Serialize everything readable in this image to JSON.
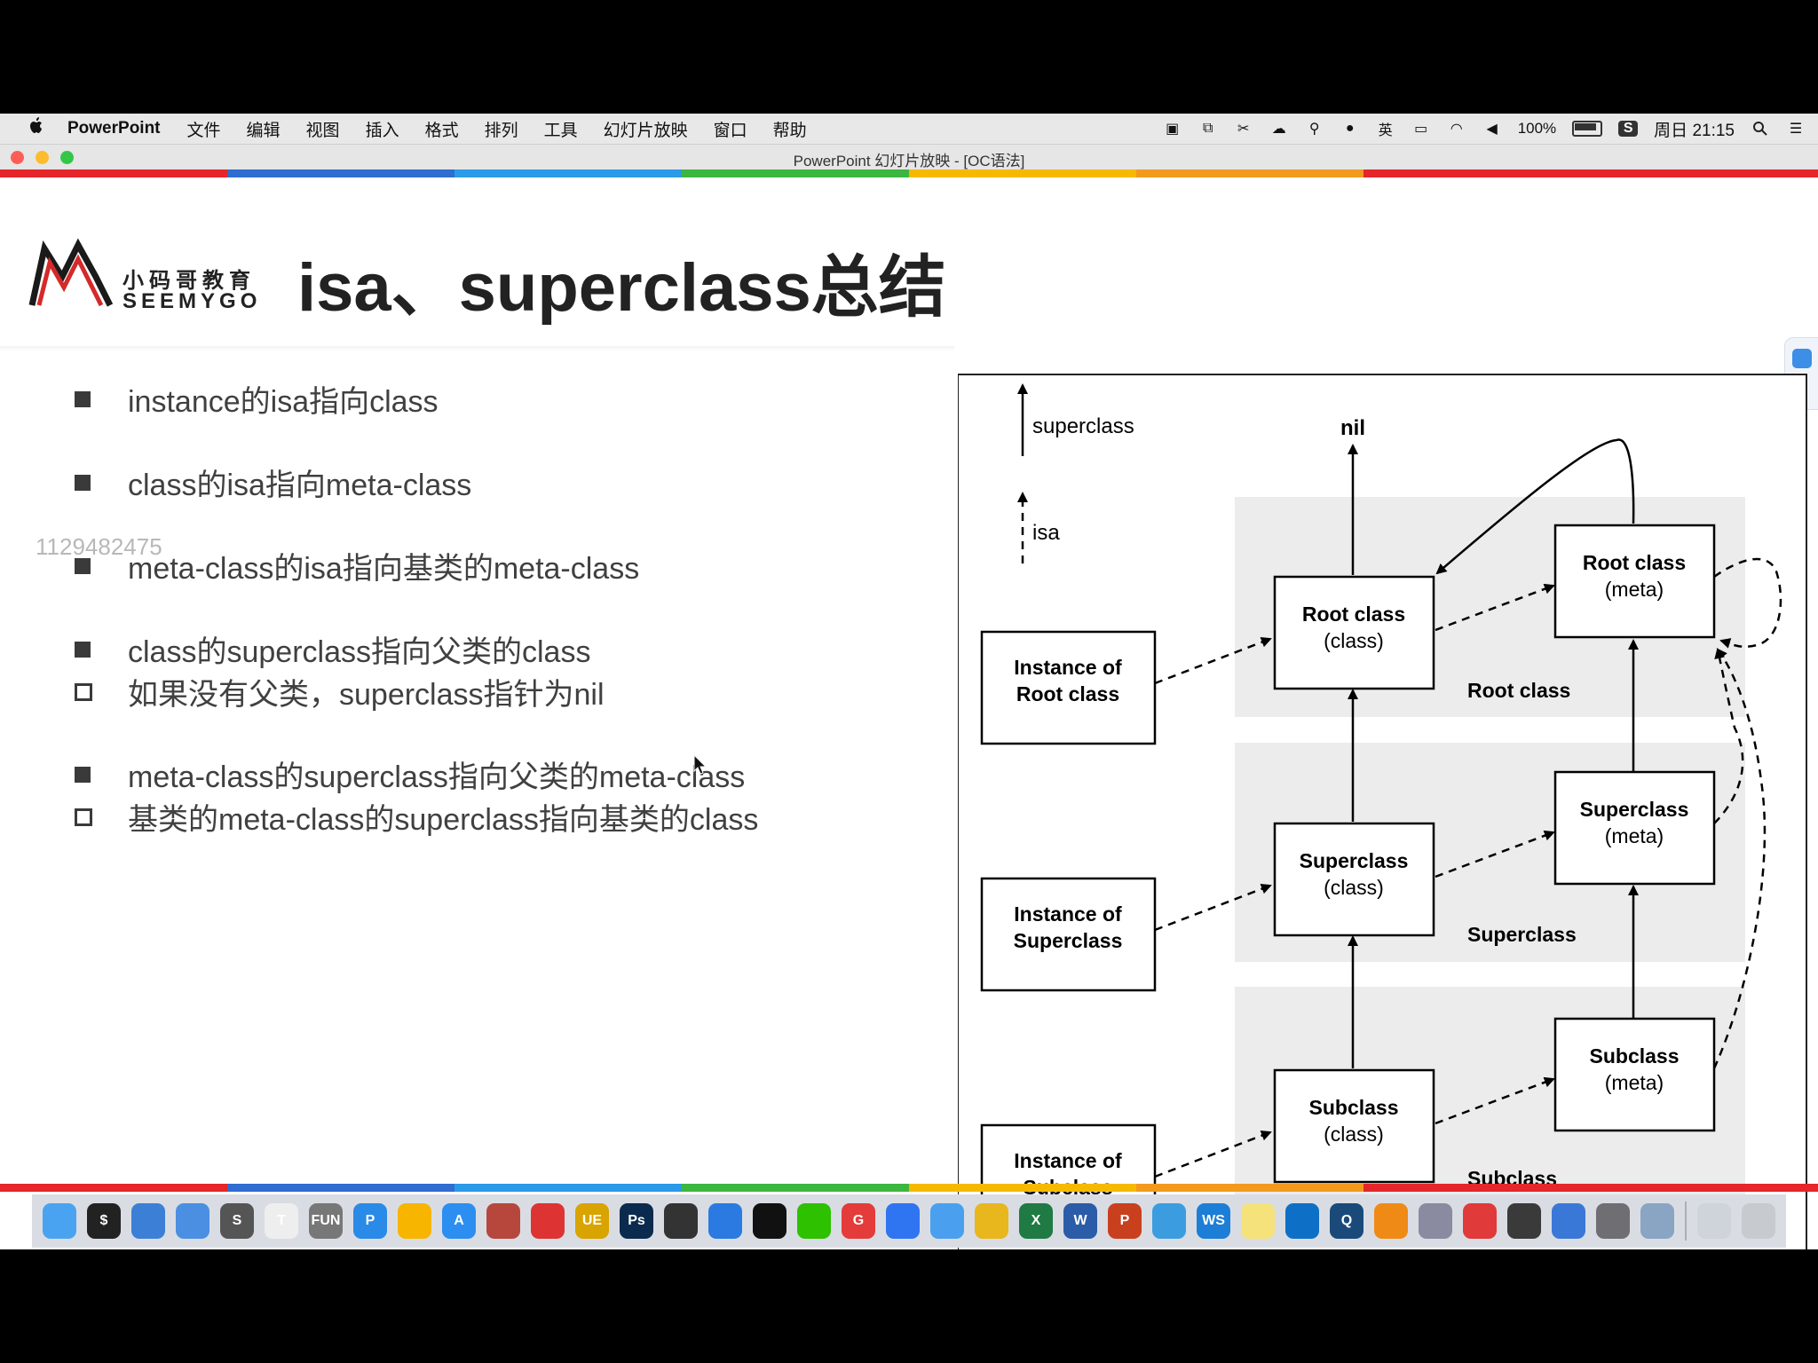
{
  "menubar": {
    "app_name": "PowerPoint",
    "items": [
      "文件",
      "编辑",
      "视图",
      "插入",
      "格式",
      "排列",
      "工具",
      "幻灯片放映",
      "窗口",
      "帮助"
    ],
    "battery": "100%",
    "clock": "周日 21:15",
    "tray_icons": [
      "screen-record-icon",
      "copy-icon",
      "scissors-icon",
      "cloud-icon",
      "network-icon",
      "mic-icon",
      "ime-icon",
      "display-icon",
      "wifi-icon",
      "volume-icon"
    ]
  },
  "window": {
    "title": "PowerPoint 幻灯片放映 - [OC语法]"
  },
  "colors": {
    "rainbow": [
      "#e5262b",
      "#2f6dd0",
      "#2b9ae8",
      "#3db63f",
      "#f7b900",
      "#f39a1e",
      "#e5262b",
      "#e5262b"
    ],
    "traffic": [
      "#fc5e57",
      "#fdbc2e",
      "#33c748"
    ]
  },
  "slide": {
    "logo_cn": "小码哥教育",
    "logo_en": "SEEMYGO",
    "title": "isa、superclass总结",
    "watermark": "1129482475",
    "bullets": [
      {
        "style": "filled",
        "text": "instance的isa指向class"
      },
      {
        "style": "filled",
        "text": "class的isa指向meta-class"
      },
      {
        "style": "filled",
        "text": "meta-class的isa指向基类的meta-class"
      },
      {
        "style": "filled",
        "text": "class的superclass指向父类的class"
      },
      {
        "style": "hollow",
        "text": "如果没有父类，superclass指针为nil"
      },
      {
        "style": "filled",
        "text": "meta-class的superclass指向父类的meta-class"
      },
      {
        "style": "hollow",
        "text": "基类的meta-class的superclass指向基类的class"
      }
    ]
  },
  "diagram": {
    "legend_superclass": "superclass",
    "legend_isa": "isa",
    "nil": "nil",
    "instances": [
      [
        "Instance of",
        "Root class"
      ],
      [
        "Instance of",
        "Superclass"
      ],
      [
        "Instance of",
        "Subclass"
      ]
    ],
    "classes": [
      [
        "Root class",
        "(class)"
      ],
      [
        "Superclass",
        "(class)"
      ],
      [
        "Subclass",
        "(class)"
      ]
    ],
    "metas": [
      [
        "Root class",
        "(meta)"
      ],
      [
        "Superclass",
        "(meta)"
      ],
      [
        "Subclass",
        "(meta)"
      ]
    ],
    "group_labels": [
      "Root class",
      "Superclass",
      "Subclass"
    ]
  },
  "dock": {
    "apps": [
      {
        "name": "finder-icon",
        "label": "",
        "color": "#4aa3f0"
      },
      {
        "name": "terminal-icon",
        "label": "$",
        "color": "#222"
      },
      {
        "name": "xcode-icon",
        "label": "",
        "color": "#3c7fd6"
      },
      {
        "name": "simulator-icon",
        "label": "",
        "color": "#4b8fe2"
      },
      {
        "name": "sublime-icon",
        "label": "S",
        "color": "#555"
      },
      {
        "name": "typora-icon",
        "label": "T",
        "color": "#eee"
      },
      {
        "name": "fun-icon",
        "label": "FUN",
        "color": "#777"
      },
      {
        "name": "pp-icon",
        "label": "P",
        "color": "#2a8ae8"
      },
      {
        "name": "sketch-icon",
        "label": "",
        "color": "#f8b500"
      },
      {
        "name": "appstore-icon",
        "label": "A",
        "color": "#2c8ef0"
      },
      {
        "name": "avatar-icon",
        "label": "",
        "color": "#b7473c"
      },
      {
        "name": "apple-icon",
        "label": "",
        "color": "#d33"
      },
      {
        "name": "ue-icon",
        "label": "UE",
        "color": "#d9a300"
      },
      {
        "name": "photoshop-icon",
        "label": "Ps",
        "color": "#0a2b4d"
      },
      {
        "name": "github-icon",
        "label": "",
        "color": "#333"
      },
      {
        "name": "edge-icon",
        "label": "",
        "color": "#2a7ae2"
      },
      {
        "name": "qq-icon",
        "label": "",
        "color": "#111"
      },
      {
        "name": "wechat-icon",
        "label": "",
        "color": "#2dc100"
      },
      {
        "name": "g-icon",
        "label": "G",
        "color": "#e43b3b"
      },
      {
        "name": "baidu-icon",
        "label": "",
        "color": "#2f74f0"
      },
      {
        "name": "feishu-icon",
        "label": "",
        "color": "#4aa0ee"
      },
      {
        "name": "chrome-icon",
        "label": "",
        "color": "#e8b61d"
      },
      {
        "name": "excel-icon",
        "label": "X",
        "color": "#1f7a44"
      },
      {
        "name": "word-icon",
        "label": "W",
        "color": "#2b5ca8"
      },
      {
        "name": "powerpoint-icon",
        "label": "P",
        "color": "#c9401e"
      },
      {
        "name": "pen-icon",
        "label": "",
        "color": "#3b9de0"
      },
      {
        "name": "ws-icon",
        "label": "WS",
        "color": "#1c7ed6"
      },
      {
        "name": "notes-icon",
        "label": "",
        "color": "#f6e27a"
      },
      {
        "name": "teamviewer-icon",
        "label": "",
        "color": "#0e6fc7"
      },
      {
        "name": "qsearch-icon",
        "label": "Q",
        "color": "#1a4a7a"
      },
      {
        "name": "vlc-icon",
        "label": "",
        "color": "#f08a16"
      },
      {
        "name": "film-icon",
        "label": "",
        "color": "#8a8aa0"
      },
      {
        "name": "netease-music-icon",
        "label": "",
        "color": "#e03a3a"
      },
      {
        "name": "speaker-icon",
        "label": "",
        "color": "#3a3a3a"
      },
      {
        "name": "screens-icon",
        "label": "",
        "color": "#3a78d8"
      },
      {
        "name": "system-preferences-icon",
        "label": "",
        "color": "#6e6e73"
      },
      {
        "name": "preview-icon",
        "label": "",
        "color": "#8aa4c4"
      },
      {
        "name": "documents-icon",
        "label": "",
        "color": "#cfd4da"
      },
      {
        "name": "trash-icon",
        "label": "",
        "color": "#c7cbd0"
      }
    ]
  }
}
